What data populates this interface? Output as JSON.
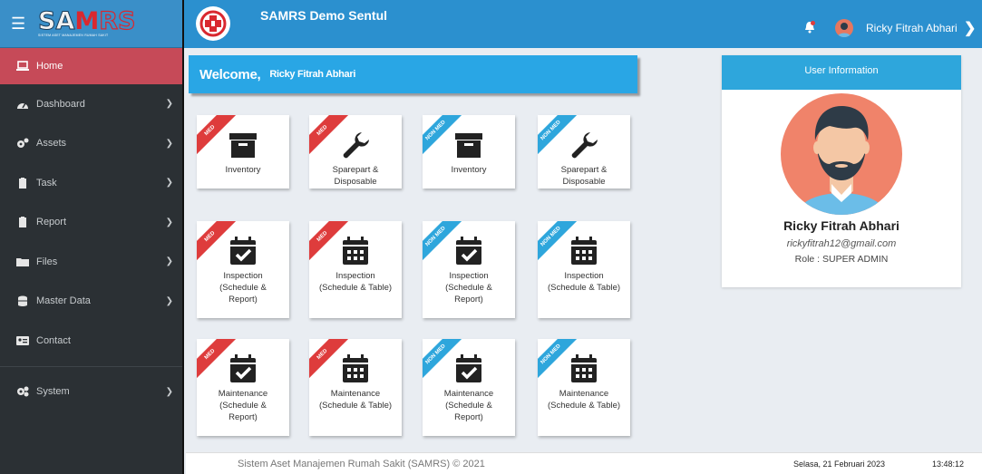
{
  "brand": {
    "logo_text": "SAMRS",
    "logo_sub": "SISTEM ASET MANAJEMEN RUMAH SAKIT"
  },
  "header": {
    "title": "SAMRS Demo Sentul",
    "user_name": "Ricky Fitrah Abhari"
  },
  "sidebar": {
    "items": [
      {
        "label": "Home",
        "icon": "laptop-icon"
      },
      {
        "label": "Dashboard",
        "icon": "tachometer-icon"
      },
      {
        "label": "Assets",
        "icon": "cogs-icon"
      },
      {
        "label": "Task",
        "icon": "clipboard-icon"
      },
      {
        "label": "Report",
        "icon": "clipboard-icon"
      },
      {
        "label": "Files",
        "icon": "folder-icon"
      },
      {
        "label": "Master Data",
        "icon": "database-icon"
      },
      {
        "label": "Contact",
        "icon": "id-card-icon"
      },
      {
        "label": "System",
        "icon": "gears-icon"
      }
    ]
  },
  "welcome": {
    "greeting": "Welcome,",
    "name": "Ricky Fitrah Abhari"
  },
  "tiles": [
    {
      "ribbon": "MED",
      "label1": "Inventory",
      "label2": ""
    },
    {
      "ribbon": "MED",
      "label1": "Sparepart &",
      "label2": "Disposable"
    },
    {
      "ribbon": "NON MED",
      "label1": "Inventory",
      "label2": ""
    },
    {
      "ribbon": "NON MED",
      "label1": "Sparepart &",
      "label2": "Disposable"
    },
    {
      "ribbon": "MED",
      "label1": "Inspection",
      "label2": "(Schedule &",
      "label3": "Report)"
    },
    {
      "ribbon": "MED",
      "label1": "Inspection",
      "label2": "(Schedule & Table)"
    },
    {
      "ribbon": "NON MED",
      "label1": "Inspection",
      "label2": "(Schedule &",
      "label3": "Report)"
    },
    {
      "ribbon": "NON MED",
      "label1": "Inspection",
      "label2": "(Schedule & Table)"
    },
    {
      "ribbon": "MED",
      "label1": "Maintenance",
      "label2": "(Schedule &",
      "label3": "Report)"
    },
    {
      "ribbon": "MED",
      "label1": "Maintenance",
      "label2": "(Schedule & Table)"
    },
    {
      "ribbon": "NON MED",
      "label1": "Maintenance",
      "label2": "(Schedule &",
      "label3": "Report)"
    },
    {
      "ribbon": "NON MED",
      "label1": "Maintenance",
      "label2": "(Schedule & Table)"
    }
  ],
  "user_info": {
    "heading": "User Information",
    "name": "Ricky Fitrah Abhari",
    "email": "rickyfitrah12@gmail.com",
    "role": "Role : SUPER ADMIN"
  },
  "footer": {
    "copyright": "Sistem Aset Manajemen Rumah Sakit (SAMRS) © 2021",
    "date": "Selasa, 21 Februari 2023",
    "time": "13:48:12"
  },
  "colors": {
    "header": "#2b90cf",
    "sidebar": "#2b3034",
    "active": "#c64a58",
    "med": "#de3c3c",
    "nonmed": "#2ea6dc"
  }
}
